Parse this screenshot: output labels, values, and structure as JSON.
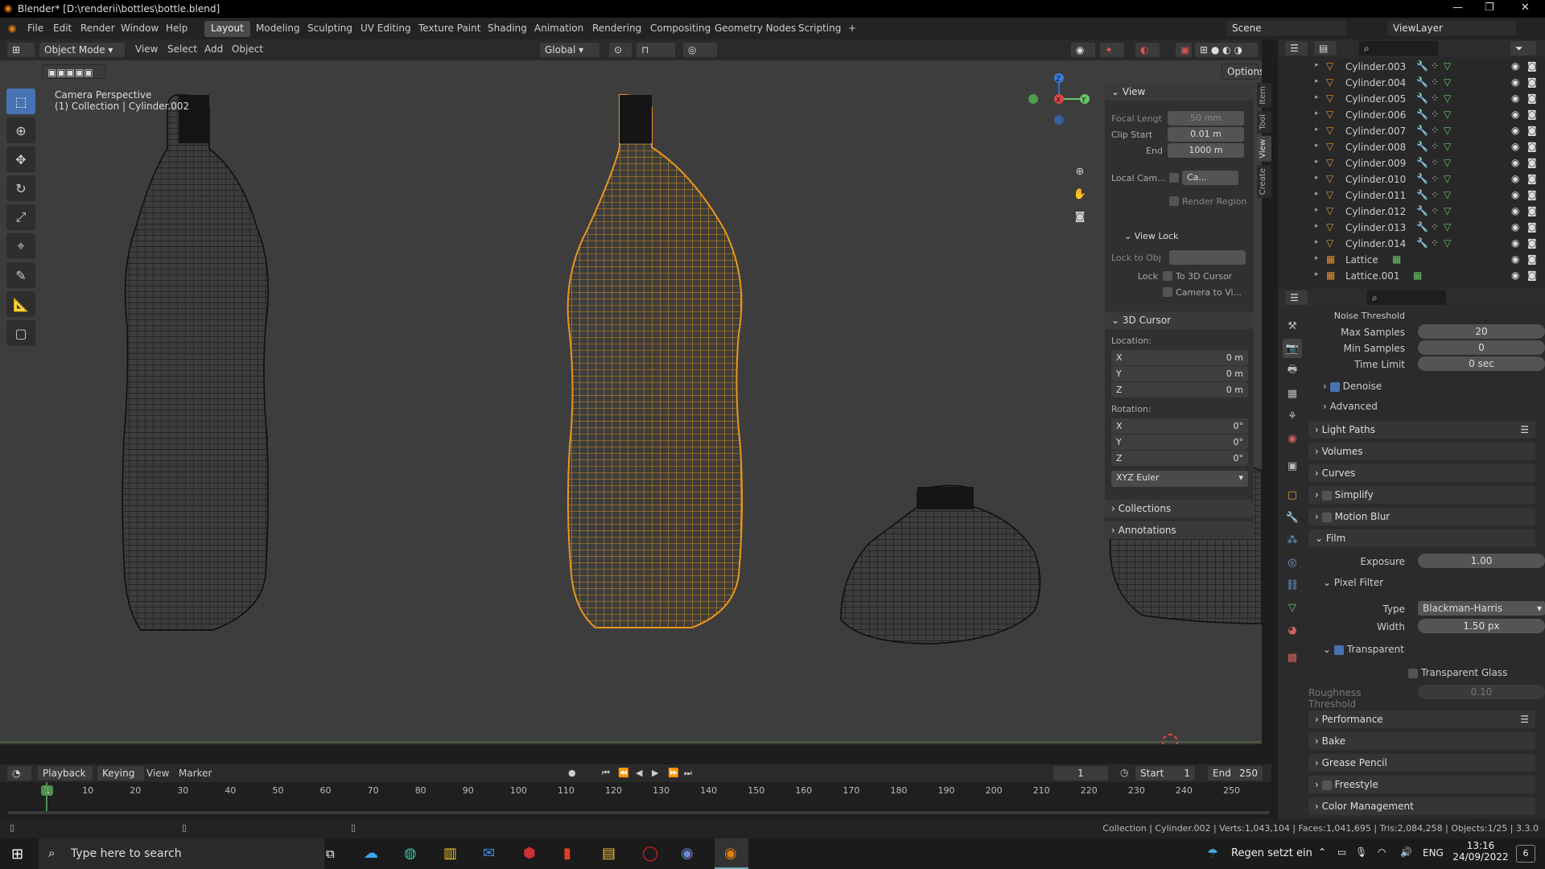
{
  "window": {
    "title": "Blender* [D:\\renderii\\bottles\\bottle.blend]"
  },
  "menus": [
    "File",
    "Edit",
    "Render",
    "Window",
    "Help"
  ],
  "workspaces": [
    "Layout",
    "Modeling",
    "Sculpting",
    "UV Editing",
    "Texture Paint",
    "Shading",
    "Animation",
    "Rendering",
    "Compositing",
    "Geometry Nodes",
    "Scripting"
  ],
  "workspace_add": "+",
  "scene": {
    "label": "Scene",
    "view_layer": "ViewLayer"
  },
  "viewport_header": {
    "mode": "Object Mode",
    "menus": [
      "View",
      "Select",
      "Add",
      "Object"
    ],
    "orientation": "Global",
    "options": "Options"
  },
  "viewport": {
    "overlay_line1": "Camera Perspective",
    "overlay_line2": "(1) Collection | Cylinder.002"
  },
  "npanel": {
    "view_header": "View",
    "focal_label": "Focal Lengt",
    "focal_value": "50 mm",
    "clip_start_label": "Clip Start",
    "clip_start_value": "0.01 m",
    "clip_end_label": "End",
    "clip_end_value": "1000 m",
    "local_cam_label": "Local Cam...",
    "local_cam_value": "Ca...",
    "render_region": "Render Region",
    "view_lock_header": "View Lock",
    "lock_to_obj": "Lock to Obj",
    "lock_label": "Lock",
    "to_3d_cursor": "To 3D Cursor",
    "camera_to_view": "Camera to Vi...",
    "cursor_header": "3D Cursor",
    "location_label": "Location:",
    "loc_x": "0 m",
    "loc_y": "0 m",
    "loc_z": "0 m",
    "rotation_label": "Rotation:",
    "rot_x": "0°",
    "rot_y": "0°",
    "rot_z": "0°",
    "rotation_mode": "XYZ Euler",
    "collections": "Collections",
    "annotations": "Annotations",
    "axis_x": "X",
    "axis_y": "Y",
    "axis_z": "Z",
    "tabs": [
      "Item",
      "Tool",
      "View",
      "Create"
    ]
  },
  "outliner": {
    "items": [
      "Cylinder.003",
      "Cylinder.004",
      "Cylinder.005",
      "Cylinder.006",
      "Cylinder.007",
      "Cylinder.008",
      "Cylinder.009",
      "Cylinder.010",
      "Cylinder.011",
      "Cylinder.012",
      "Cylinder.013",
      "Cylinder.014",
      "Lattice",
      "Lattice.001"
    ]
  },
  "properties": {
    "noise_threshold": "Noise Threshold",
    "max_samples_label": "Max Samples",
    "max_samples": "20",
    "min_samples_label": "Min Samples",
    "min_samples": "0",
    "time_limit_label": "Time Limit",
    "time_limit": "0 sec",
    "denoise": "Denoise",
    "advanced": "Advanced",
    "light_paths": "Light Paths",
    "volumes": "Volumes",
    "curves": "Curves",
    "simplify": "Simplify",
    "motion_blur": "Motion Blur",
    "film": "Film",
    "exposure_label": "Exposure",
    "exposure": "1.00",
    "pixel_filter": "Pixel Filter",
    "type_label": "Type",
    "type_value": "Blackman-Harris",
    "width_label": "Width",
    "width_value": "1.50 px",
    "transparent": "Transparent",
    "transparent_glass": "Transparent Glass",
    "roughness_label": "Roughness Threshold",
    "roughness_value": "0.10",
    "performance": "Performance",
    "bake": "Bake",
    "grease_pencil": "Grease Pencil",
    "freestyle": "Freestyle",
    "color_management": "Color Management"
  },
  "timeline": {
    "menus": [
      "Playback",
      "Keying",
      "View",
      "Marker"
    ],
    "current_frame": "1",
    "start_label": "Start",
    "start": "1",
    "end_label": "End",
    "end": "250",
    "ticks": [
      "1",
      "10",
      "20",
      "30",
      "40",
      "50",
      "60",
      "70",
      "80",
      "90",
      "100",
      "110",
      "120",
      "130",
      "140",
      "150",
      "160",
      "170",
      "180",
      "190",
      "200",
      "210",
      "220",
      "230",
      "240",
      "250"
    ]
  },
  "status": {
    "text": "Collection | Cylinder.002 | Verts:1,043,104 | Faces:1,041,695 | Tris:2,084,258 | Objects:1/25 | 3.3.0"
  },
  "taskbar": {
    "search_placeholder": "Type here to search",
    "weather": "Regen setzt ein",
    "lang": "ENG",
    "time": "13:16",
    "date": "24/09/2022",
    "notif_count": "6"
  }
}
